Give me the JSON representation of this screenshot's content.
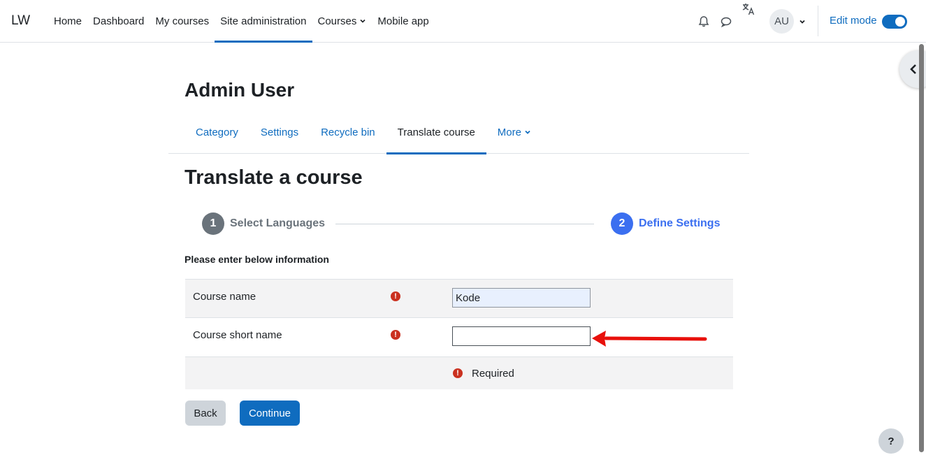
{
  "navbar": {
    "brand": "LW",
    "items": [
      {
        "label": "Home"
      },
      {
        "label": "Dashboard"
      },
      {
        "label": "My courses"
      },
      {
        "label": "Site administration"
      },
      {
        "label": "Courses"
      },
      {
        "label": "Mobile app"
      }
    ],
    "active_item": "Site administration",
    "avatar_initials": "AU",
    "edit_mode_label": "Edit mode",
    "edit_mode_on": true
  },
  "page": {
    "heading": "Admin User",
    "secondary_nav": [
      {
        "label": "Category"
      },
      {
        "label": "Settings"
      },
      {
        "label": "Recycle bin"
      },
      {
        "label": "Translate course"
      },
      {
        "label": "More"
      }
    ],
    "active_tab": "Translate course",
    "title": "Translate a course"
  },
  "stepper": {
    "steps": [
      {
        "number": "1",
        "label": "Select Languages"
      },
      {
        "number": "2",
        "label": "Define Settings"
      }
    ],
    "current_step": 2
  },
  "form": {
    "intro": "Please enter below information",
    "course_name_label": "Course name",
    "course_name_value": "Kode",
    "course_short_name_label": "Course short name",
    "course_short_name_value": "",
    "required_message": "Required",
    "required_icon": "!"
  },
  "buttons": {
    "back": "Back",
    "continue": "Continue",
    "help": "?"
  },
  "colors": {
    "primary": "#0f6cbf",
    "step_active": "#3b6ff0",
    "step_inactive": "#6a737b",
    "error": "#ca3120",
    "annotation_arrow": "#e8100b"
  }
}
